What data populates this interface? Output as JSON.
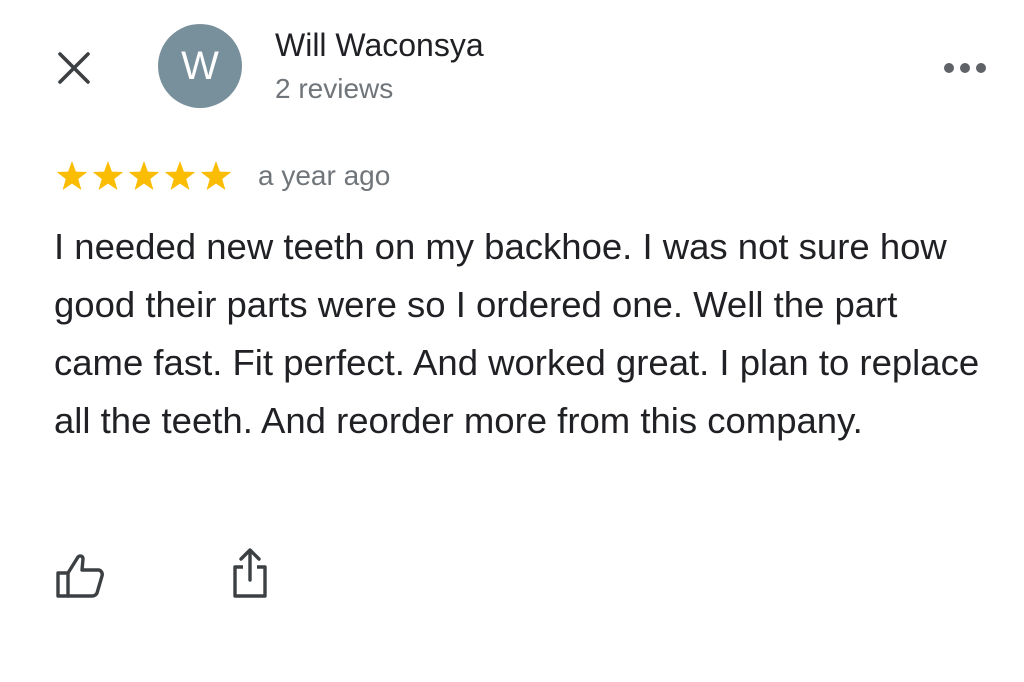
{
  "header": {
    "close_icon": "close-icon",
    "avatar_letter": "W",
    "avatar_color": "#78909c",
    "reviewer_name": "Will Waconsya",
    "reviewer_reviews": "2 reviews",
    "more_icon": "more-horizontal-icon"
  },
  "review": {
    "rating": 5,
    "rating_max": 5,
    "star_color": "#fbbc04",
    "time": "a year ago",
    "text": "I needed new teeth on my backhoe. I was not sure how good their parts were so I ordered one. Well the part came fast. Fit perfect. And worked great. I plan to replace all the teeth. And reorder more from this company."
  },
  "actions": {
    "like_icon": "thumbs-up-icon",
    "share_icon": "share-icon"
  }
}
